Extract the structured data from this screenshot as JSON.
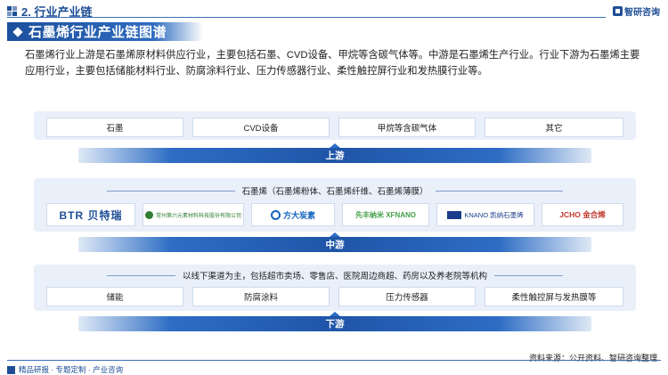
{
  "header": {
    "section_title": "2. 行业产业链",
    "brand": "智研咨询"
  },
  "banner": {
    "title": "石墨烯行业产业链图谱"
  },
  "intro": "石墨烯行业上游是石墨烯原材料供应行业，主要包括石墨、CVD设备、甲烷等含碳气体等。中游是石墨烯生产行业。行业下游为石墨烯主要应用行业，主要包括储能材料行业、防腐涂料行业、压力传感器行业、柔性触控屏行业和发热膜行业等。",
  "upstream": {
    "items": [
      "石墨",
      "CVD设备",
      "甲烷等含碳气体",
      "其它"
    ],
    "label": "上游"
  },
  "midstream": {
    "heading": "石墨烯（石墨烯粉体、石墨烯纤维、石墨烯薄膜）",
    "companies": [
      {
        "name": "BTR 贝特瑞",
        "color": "#1f4e96"
      },
      {
        "name": "常州第六元素材料科技股份有限公司",
        "color": "#2e7d32"
      },
      {
        "name": "方大炭素",
        "color": "#1565c0"
      },
      {
        "name": "先丰纳米 XFNANO",
        "color": "#43a047"
      },
      {
        "name": "KNANO 凯纳石墨烯",
        "color": "#1a3c8c"
      },
      {
        "name": "JCHO 金合烯",
        "color": "#c0392b"
      }
    ],
    "label": "中游"
  },
  "downstream": {
    "heading": "以线下渠道为主，包括超市卖场、零售店、医院周边商超、药房以及养老院等机构",
    "items": [
      "储能",
      "防腐涂料",
      "压力传感器",
      "柔性触控屏与发热膜等"
    ],
    "label": "下游"
  },
  "footer": {
    "left": "精品研报 · 专题定制 · 产业咨询",
    "source": "资料来源：公开资料、智研咨询整理"
  }
}
